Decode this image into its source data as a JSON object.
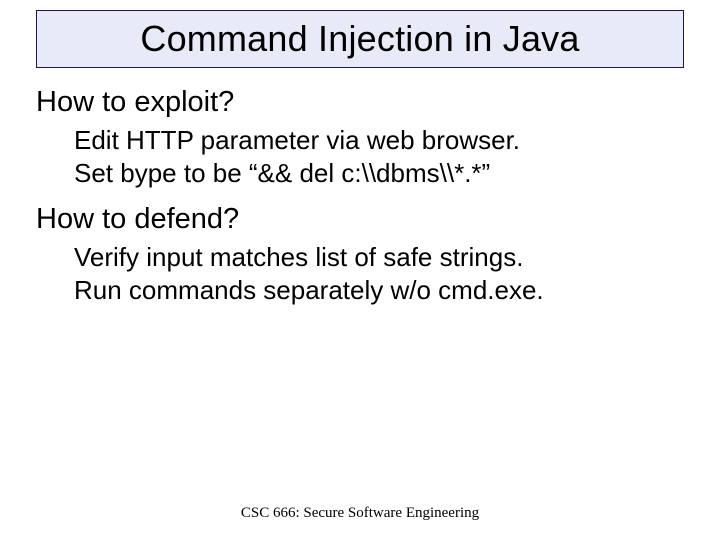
{
  "title": "Command Injection in Java",
  "sections": [
    {
      "heading": "How to exploit?",
      "lines": [
        "Edit HTTP parameter via web browser.",
        "Set bype to be “&& del c:\\\\dbms\\\\*.*”"
      ]
    },
    {
      "heading": "How to defend?",
      "lines": [
        "Verify input matches list of safe strings.",
        "Run commands separately w/o cmd.exe."
      ]
    }
  ],
  "footer": "CSC 666: Secure Software Engineering"
}
